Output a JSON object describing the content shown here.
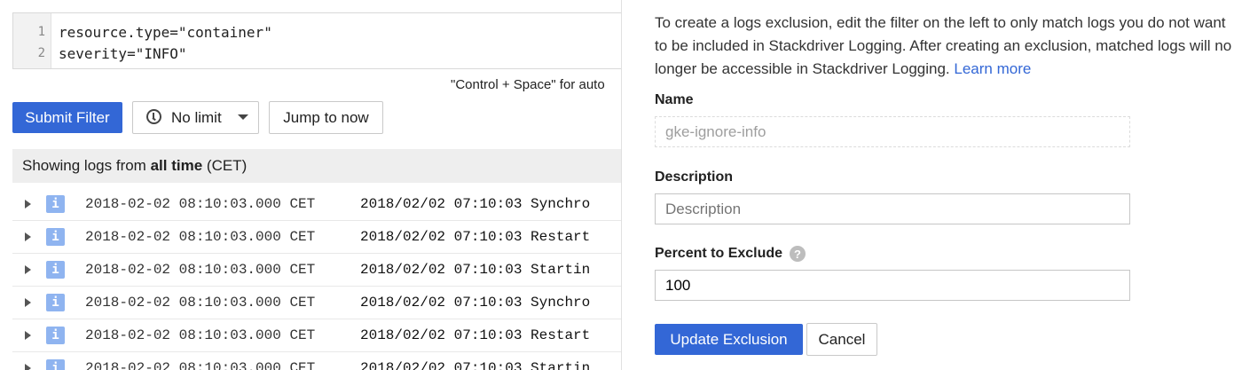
{
  "editor": {
    "lines": [
      {
        "number": "1",
        "text": "resource.type=\"container\""
      },
      {
        "number": "2",
        "text": "severity=\"INFO\""
      }
    ],
    "hint": "\"Control + Space\" for auto"
  },
  "toolbar": {
    "submit_label": "Submit Filter",
    "time_select_value": "No limit",
    "jump_label": "Jump to now"
  },
  "range": {
    "prefix": "Showing logs from",
    "period": "all time",
    "timezone": "(CET)"
  },
  "log_rows": [
    {
      "severity": "i",
      "timestamp": "2018-02-02 08:10:03.000 CET",
      "message": "2018/02/02 07:10:03 Synchro"
    },
    {
      "severity": "i",
      "timestamp": "2018-02-02 08:10:03.000 CET",
      "message": "2018/02/02 07:10:03 Restart"
    },
    {
      "severity": "i",
      "timestamp": "2018-02-02 08:10:03.000 CET",
      "message": "2018/02/02 07:10:03 Startin"
    },
    {
      "severity": "i",
      "timestamp": "2018-02-02 08:10:03.000 CET",
      "message": "2018/02/02 07:10:03 Synchro"
    },
    {
      "severity": "i",
      "timestamp": "2018-02-02 08:10:03.000 CET",
      "message": "2018/02/02 07:10:03 Restart"
    },
    {
      "severity": "i",
      "timestamp": "2018-02-02 08:10:03.000 CET",
      "message": "2018/02/02 07:10:03 Startin"
    }
  ],
  "panel": {
    "description": "To create a logs exclusion, edit the filter on the left to only match logs you do not want to be included in Stackdriver Logging. After creating an exclusion, matched logs will no longer be accessible in Stackdriver Logging.",
    "learn_more": "Learn more",
    "name_label": "Name",
    "name_value": "gke-ignore-info",
    "description_label": "Description",
    "description_placeholder": "Description",
    "percent_label": "Percent to Exclude",
    "percent_value": "100",
    "help_glyph": "?",
    "update_label": "Update Exclusion",
    "cancel_label": "Cancel"
  },
  "colors": {
    "primary": "#3367d6",
    "info_badge": "#8fb4f0"
  },
  "icons": {
    "time_select": "clock-icon",
    "dropdown": "chevron-down-icon",
    "row_expand": "expand-arrow-icon",
    "help": "help-icon"
  }
}
